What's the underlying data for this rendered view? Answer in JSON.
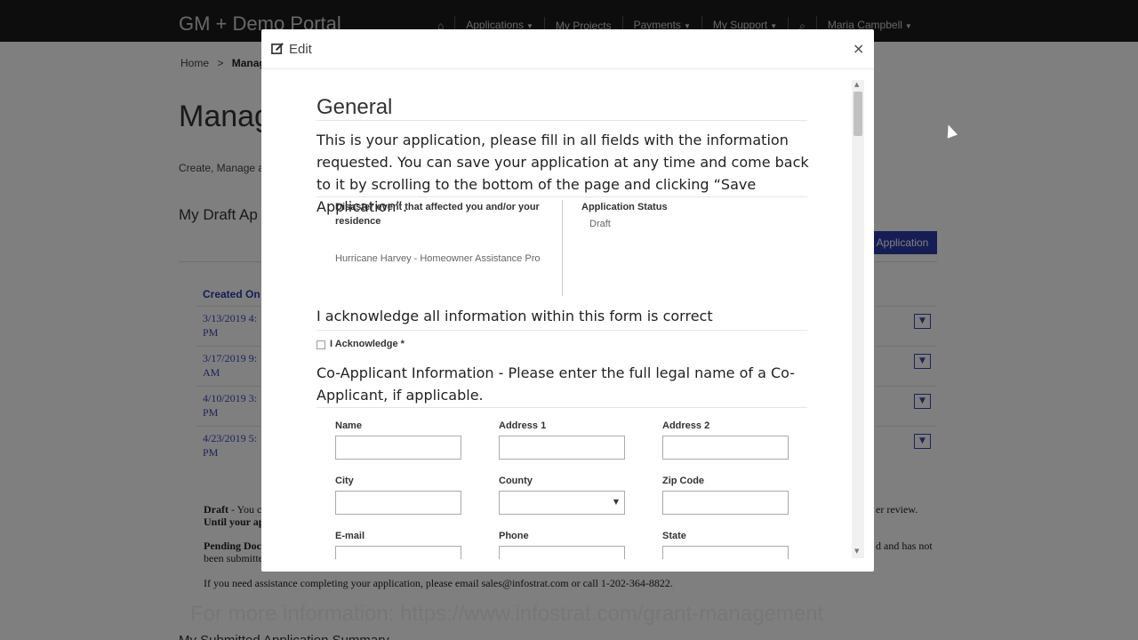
{
  "header": {
    "brand": "GM + Demo Portal",
    "nav": [
      {
        "label": "⌂",
        "caret": false
      },
      {
        "label": "Applications",
        "caret": true
      },
      {
        "label": "My Projects",
        "caret": false
      },
      {
        "label": "Payments",
        "caret": true
      },
      {
        "label": "My Support",
        "caret": true
      },
      {
        "label": "⌕",
        "caret": false
      },
      {
        "label": "Maria Campbell",
        "caret": true
      }
    ]
  },
  "page": {
    "breadcrumb_home": "Home",
    "breadcrumb_sep": ">",
    "breadcrumb_current": "Manag",
    "title": "Manag",
    "description": "Create, Manage an",
    "section_title": "My Draft Ap",
    "new_button": "Application",
    "column_header": "Created On",
    "rows": [
      {
        "date": "3/13/2019 4:",
        "time": "PM"
      },
      {
        "date": "3/17/2019 9:",
        "time": "AM"
      },
      {
        "date": "4/10/2019 3:",
        "time": "PM"
      },
      {
        "date": "4/23/2019 5:",
        "time": "PM"
      }
    ],
    "legend_draft_label": "Draft",
    "legend_draft_text": "- You c",
    "legend_draft_line2": "Until your ap",
    "legend_draft_right": "er review.",
    "legend_pending_label": "Pending Doc",
    "legend_pending_line2": "been submitte",
    "legend_pending_right": "d and has not",
    "assistance": "If you need assistance completing your application, please email sales@infostrat.com or call 1-202-364-8822.",
    "cut_title": "My Submitted Application Summary"
  },
  "modal": {
    "title": "Edit",
    "close": "×",
    "general_title": "General",
    "general_desc": "This is your application, please fill in all fields with the information requested. You can save your application at any time and come back to it by scrolling to the bottom of the page and clicking “Save Application”.",
    "disaster_label": "Disaster event that affected you and/or your residence",
    "disaster_value": "Hurricane Harvey - Homeowner Assistance Pro",
    "status_label": "Application Status",
    "status_value": "Draft",
    "acknowledge_heading": "I acknowledge all information within this form is correct",
    "acknowledge_label": "I Acknowledge *",
    "coapp_heading": "Co-Applicant Information - Please enter the full legal name of a Co-Applicant, if applicable.",
    "fields": {
      "name": "Name",
      "address1": "Address 1",
      "address2": "Address 2",
      "city": "City",
      "county": "County",
      "zip": "Zip Code",
      "email": "E-mail",
      "phone": "Phone",
      "state": "State"
    }
  },
  "footer": {
    "info": "For more information: https://www.infostrat.com/grant-management"
  }
}
